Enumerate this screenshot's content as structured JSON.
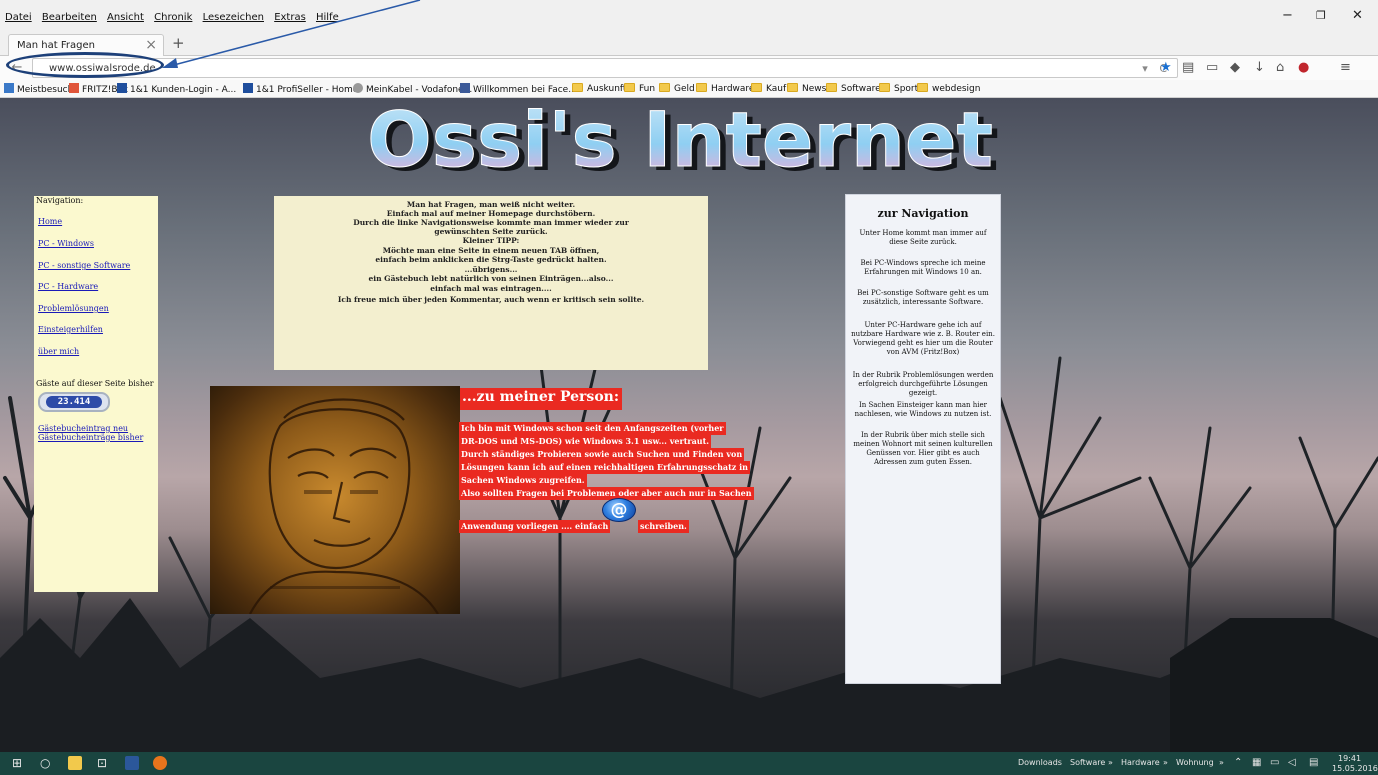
{
  "browser": {
    "menu": [
      "Datei",
      "Bearbeiten",
      "Ansicht",
      "Chronik",
      "Lesezeichen",
      "Extras",
      "Hilfe"
    ],
    "tab_title": "Man hat Fragen",
    "url": "www.ossiwalsrode.de",
    "bookmarks": [
      "Meistbesucht",
      "FRITZ!Box",
      "1&1 Kunden-Login - A...",
      "1&1 ProfiSeller - Home",
      "MeinKabel - Vodafone...",
      "Willkommen bei Face...",
      "Auskunft",
      "Fun",
      "Geld",
      "Hardware",
      "Kauf",
      "News",
      "Software",
      "Sport",
      "webdesign"
    ]
  },
  "site": {
    "logo_text": "Ossi's Internet",
    "nav": {
      "heading": "Navigation:",
      "links": [
        "Home",
        "PC - Windows",
        "PC - sonstige Software",
        "PC - Hardware",
        "Problemlösungen",
        "Einsteigerhilfen",
        "über mich"
      ],
      "visitor_label": "Gäste auf dieser Seite bisher",
      "counter": "23.414",
      "guestbook_new": "Gästebucheintrag neu",
      "guestbook_entries": "Gästebucheinträge bisher"
    },
    "intro_lines": [
      "Man hat Fragen, man weiß nicht weiter.",
      "Einfach mal auf meiner Homepage durchstöbern.",
      "Durch die linke Navigationsweise kommte man immer wieder zur",
      "gewünschten Seite zurück.",
      "Kleiner TIPP:",
      "Möchte man eine Seite in einem neuen TAB öffnen,",
      "einfach beim anklicken die Strg-Taste gedrückt halten.",
      "...übrigens...",
      "ein Gästebuch lebt natürlich von seinen Einträgen...also...",
      "einfach mal was eintragen....",
      "Ich freue mich über jeden Kommentar, auch wenn er kritisch sein sollte."
    ],
    "person": {
      "heading": "...zu meiner Person:",
      "lines": [
        "Ich bin mit Windows schon seit den Anfangszeiten (vorher",
        "DR-DOS und MS-DOS) wie Windows 3.1 usw... vertraut.",
        "Durch ständiges Probieren sowie auch Suchen und Finden von",
        "Lösungen kann ich auf einen reichhaltigen Erfahrungsschatz in",
        "Sachen Windows zugreifen.",
        "Also sollten Fragen bei Problemen oder aber auch nur in Sachen"
      ],
      "last_line_start": "Anwendung vorliegen .... einfach",
      "last_line_end": "schreiben.",
      "at_symbol": "@"
    },
    "right_panel": {
      "title": "zur Navigation",
      "paragraphs": [
        "Unter Home kommt man immer auf diese Seite zurück.",
        "Bei PC-Windows spreche ich meine Erfahrungen mit Windows 10 an.",
        "Bei PC-sonstige Software geht es um zusätzlich, interessante Software.",
        "Unter PC-Hardware gehe ich auf nutzbare Hardware wie z. B. Router ein. Vorwiegend geht es hier um die Router von AVM (Fritz!Box)",
        "In der Rubrik Problemlösungen werden erfolgreich durchgeführte Lösungen gezeigt.",
        "In Sachen Einsteiger kann man hier nachlesen, wie Windows zu nutzen ist.",
        "In der Rubrik über mich stelle sich meinen Wohnort mit seinen kulturellen Genüssen vor. Hier gibt es auch Adressen zum guten Essen."
      ]
    }
  },
  "taskbar": {
    "items": [
      "Downloads",
      "Software",
      "Hardware",
      "Wohnung"
    ],
    "time": "19:41",
    "date": "15.05.2016"
  },
  "colors": {
    "nav_panel": "#fbf9cf",
    "info_box": "#f3efcf",
    "person_red": "#ea2a21",
    "right_panel": "#f1f3f8",
    "taskbar": "#1a4540",
    "annotation": "#1d4079"
  }
}
